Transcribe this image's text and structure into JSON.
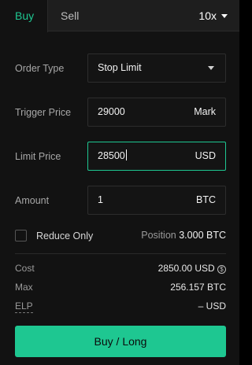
{
  "tabs": {
    "buy": "Buy",
    "sell": "Sell",
    "leverage": "10x"
  },
  "order_type": {
    "label": "Order Type",
    "value": "Stop Limit"
  },
  "trigger_price": {
    "label": "Trigger Price",
    "value": "29000",
    "unit": "Mark"
  },
  "limit_price": {
    "label": "Limit Price",
    "value": "28500",
    "unit": "USD"
  },
  "amount": {
    "label": "Amount",
    "value": "1",
    "unit": "BTC"
  },
  "reduce_only": {
    "label": "Reduce Only",
    "checked": false
  },
  "position": {
    "label": "Position",
    "value": "3.000 BTC"
  },
  "summary": {
    "cost_label": "Cost",
    "cost_value": "2850.00 USD",
    "max_label": "Max",
    "max_value": "256.157 BTC",
    "elp_label": "ELP",
    "elp_value": "– USD"
  },
  "submit": {
    "label": "Buy / Long"
  },
  "colors": {
    "accent": "#1ec791",
    "background": "#121212"
  },
  "icons": {
    "usd": "usd-circle-icon",
    "caret": "chevron-down-icon"
  }
}
